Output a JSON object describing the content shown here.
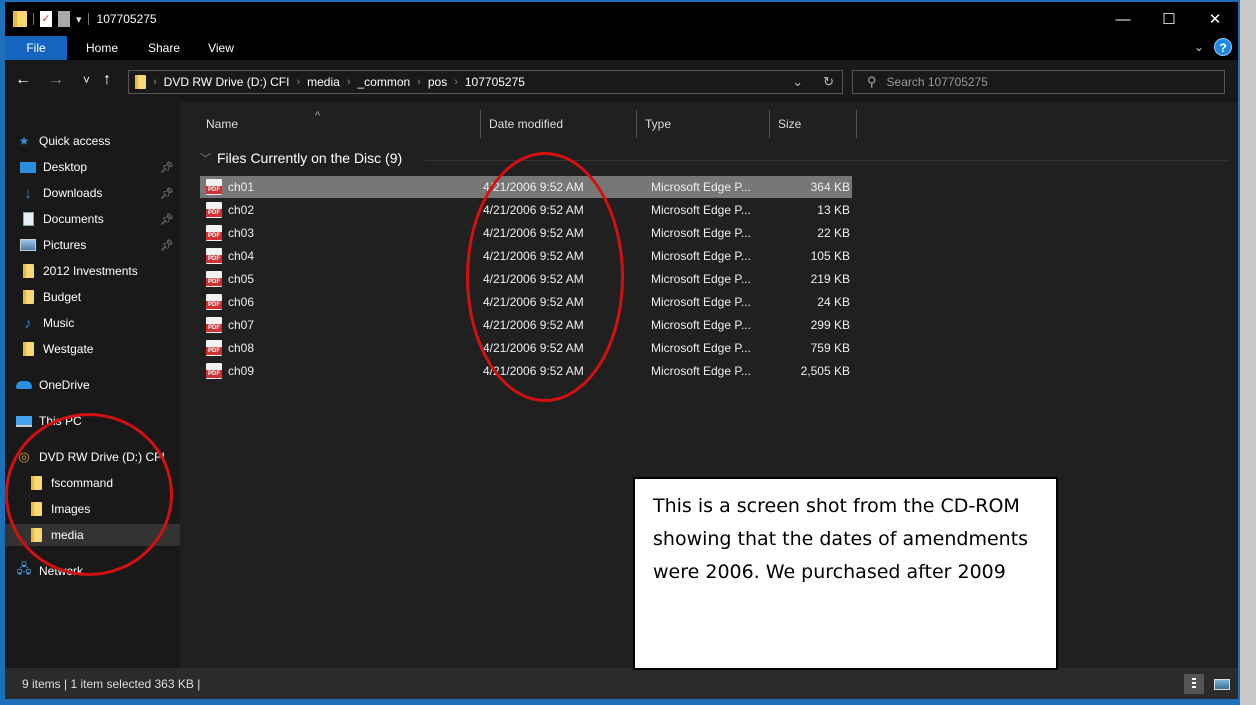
{
  "window": {
    "title": "107705275",
    "controls": {
      "minimize": "—",
      "maximize": "☐",
      "close": "✕"
    }
  },
  "ribbon": {
    "tabs": [
      "File",
      "Home",
      "Share",
      "View"
    ],
    "help": "?"
  },
  "navigation": {
    "back": "←",
    "forward": "→",
    "recent": "˅",
    "up": "↑"
  },
  "address_bar": {
    "crumbs": [
      "DVD RW Drive (D:) CFI",
      "media",
      "_common",
      "pos",
      "107705275"
    ],
    "separator": "›"
  },
  "search": {
    "placeholder": "Search 107705275"
  },
  "sidebar": {
    "quick_access": "Quick access",
    "items": [
      {
        "label": "Desktop",
        "icon": "desktop-icon",
        "pinned": true
      },
      {
        "label": "Downloads",
        "icon": "download-icon",
        "pinned": true
      },
      {
        "label": "Documents",
        "icon": "documents-icon",
        "pinned": true
      },
      {
        "label": "Pictures",
        "icon": "pictures-icon",
        "pinned": true
      },
      {
        "label": "2012 Investments",
        "icon": "folder-icon",
        "pinned": false
      },
      {
        "label": "Budget",
        "icon": "folder-icon",
        "pinned": false
      },
      {
        "label": "Music",
        "icon": "music-icon",
        "pinned": false
      },
      {
        "label": "Westgate",
        "icon": "folder-icon",
        "pinned": false
      }
    ],
    "onedrive": "OneDrive",
    "this_pc": "This PC",
    "drive": "DVD RW Drive (D:) CFI",
    "drive_children": [
      "fscommand",
      "Images",
      "media"
    ],
    "selected": "media",
    "network": "Network"
  },
  "columns": {
    "name": "Name",
    "date": "Date modified",
    "type": "Type",
    "size": "Size"
  },
  "group": {
    "label": "Files Currently on the Disc (9)"
  },
  "files": [
    {
      "name": "ch01",
      "date": "4/21/2006 9:52 AM",
      "type": "Microsoft Edge P...",
      "size": "364 KB",
      "selected": true
    },
    {
      "name": "ch02",
      "date": "4/21/2006 9:52 AM",
      "type": "Microsoft Edge P...",
      "size": "13 KB"
    },
    {
      "name": "ch03",
      "date": "4/21/2006 9:52 AM",
      "type": "Microsoft Edge P...",
      "size": "22 KB"
    },
    {
      "name": "ch04",
      "date": "4/21/2006 9:52 AM",
      "type": "Microsoft Edge P...",
      "size": "105 KB"
    },
    {
      "name": "ch05",
      "date": "4/21/2006 9:52 AM",
      "type": "Microsoft Edge P...",
      "size": "219 KB"
    },
    {
      "name": "ch06",
      "date": "4/21/2006 9:52 AM",
      "type": "Microsoft Edge P...",
      "size": "24 KB"
    },
    {
      "name": "ch07",
      "date": "4/21/2006 9:52 AM",
      "type": "Microsoft Edge P...",
      "size": "299 KB"
    },
    {
      "name": "ch08",
      "date": "4/21/2006 9:52 AM",
      "type": "Microsoft Edge P...",
      "size": "759 KB"
    },
    {
      "name": "ch09",
      "date": "4/21/2006 9:52 AM",
      "type": "Microsoft Edge P...",
      "size": "2,505 KB"
    }
  ],
  "status": {
    "text": "9 items  |  1 item selected  363 KB  |"
  },
  "annotation": {
    "text": "This is a screen shot from the CD-ROM showing that the dates of amendments were 2006.  We purchased after 2009"
  },
  "colors": {
    "accent": "#1c6fb8",
    "highlight_oval": "#d41010"
  }
}
